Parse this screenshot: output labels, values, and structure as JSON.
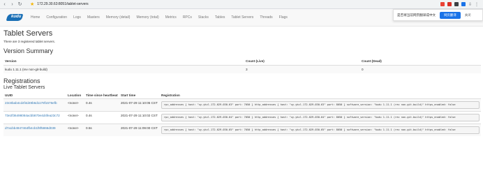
{
  "browser": {
    "back_icon": "arrow-left-icon",
    "forward_icon": "arrow-right-icon",
    "reload_icon": "reload-icon",
    "url": "172.29.30.63:8051/tablet-servers"
  },
  "translate_popup": {
    "text": "是否将当前网页翻译成中文",
    "button": "网页翻译",
    "close": "关闭"
  },
  "navbar": {
    "logo_text": "kudu",
    "items": [
      "Home",
      "Configuration",
      "Logs",
      "Masters",
      "Memory (detail)",
      "Memory (total)",
      "Metrics",
      "RPCs",
      "Stacks",
      "Tables",
      "Tablet Servers",
      "Threads",
      "Flags"
    ]
  },
  "page": {
    "title": "Tablet Servers",
    "count_note": "There are 3 registered tablet servers.",
    "version_summary_heading": "Version Summary",
    "version_table": {
      "headers": [
        "Version",
        "Count (Live)",
        "Count (Dead)"
      ],
      "rows": [
        [
          "kudu 1.11.1 (rev non-git-build)",
          "3",
          "0"
        ]
      ]
    },
    "registrations_heading": "Registrations",
    "live_heading": "Live Tablet Servers",
    "servers_table": {
      "headers": [
        "UUID",
        "Location",
        "Time since heartbeat",
        "Start time",
        "Registration"
      ],
      "rows": [
        {
          "uuid": "23c8bab4cd4f4d49b6d1178f1576efb",
          "location": "<none>",
          "heartbeat": "0.4s",
          "start": "2021-07-29 11:10:05 CST",
          "registration": "rpc_addresses { host: \"uy-ykcl-172-029-030-63\" port: 7050 } http_addresses { host: \"uy-ykcl-172-029-030-63\" port: 8050 } software_version: \"kudu 1.11.1 (rev non-git-build)\" https_enabled: false"
        },
        {
          "uuid": "73e2f3649808​4acbb870e4d4fea23c72",
          "location": "<none>",
          "heartbeat": "0.4s",
          "start": "2021-07-29 11:10:02 CST",
          "registration": "rpc_addresses { host: \"uy-ykcl-172-029-030-64\" port: 7050 } http_addresses { host: \"uy-ykcl-172-029-030-64\" port: 8050 } software_version: \"kudu 1.11.1 (rev non-git-build)\" https_enabled: false"
        },
        {
          "uuid": "d7a1bb4947464fb4cb1f8f5866d039",
          "location": "<none>",
          "heartbeat": "0.5s",
          "start": "2021-07-29 11:09:00 CST",
          "registration": "rpc_addresses { host: \"uy-ykcl-172-029-030-65\" port: 7050 } http_addresses { host: \"uy-ykcl-172-029-030-65\" port: 8050 } software_version: \"kudu 1.11.1 (rev non-git-build)\" https_enabled: false"
        }
      ]
    }
  }
}
